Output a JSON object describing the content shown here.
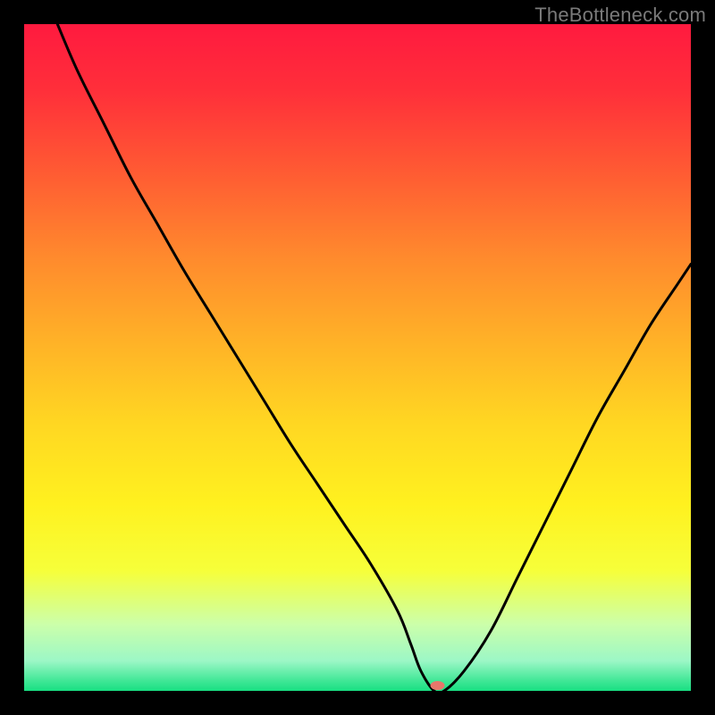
{
  "watermark": "TheBottleneck.com",
  "chart_data": {
    "type": "line",
    "title": "",
    "xlabel": "",
    "ylabel": "",
    "xlim": [
      0,
      100
    ],
    "ylim": [
      0,
      100
    ],
    "background_gradient": {
      "stops": [
        {
          "offset": 0.0,
          "color": "#ff1a3f"
        },
        {
          "offset": 0.1,
          "color": "#ff2f3a"
        },
        {
          "offset": 0.22,
          "color": "#ff5a33"
        },
        {
          "offset": 0.35,
          "color": "#ff8a2d"
        },
        {
          "offset": 0.48,
          "color": "#ffb327"
        },
        {
          "offset": 0.6,
          "color": "#ffd722"
        },
        {
          "offset": 0.72,
          "color": "#fff11f"
        },
        {
          "offset": 0.82,
          "color": "#f6ff3a"
        },
        {
          "offset": 0.9,
          "color": "#ccffaa"
        },
        {
          "offset": 0.955,
          "color": "#9cf7c6"
        },
        {
          "offset": 0.985,
          "color": "#40e796"
        },
        {
          "offset": 1.0,
          "color": "#18df82"
        }
      ]
    },
    "curve": {
      "x": [
        5,
        8,
        12,
        16,
        20,
        24,
        28,
        32,
        36,
        40,
        44,
        48,
        52,
        56,
        58,
        59.5,
        61.5,
        63,
        66,
        70,
        74,
        78,
        82,
        86,
        90,
        94,
        98,
        100
      ],
      "y": [
        100,
        93,
        85,
        77,
        70,
        63,
        56.5,
        50,
        43.5,
        37,
        31,
        25,
        19,
        12,
        7,
        3,
        0,
        0,
        3,
        9,
        17,
        25,
        33,
        41,
        48,
        55,
        61,
        64
      ]
    },
    "marker": {
      "x": 62,
      "y": 0.8,
      "color": "#e6776b",
      "rx": 8,
      "ry": 5
    }
  }
}
